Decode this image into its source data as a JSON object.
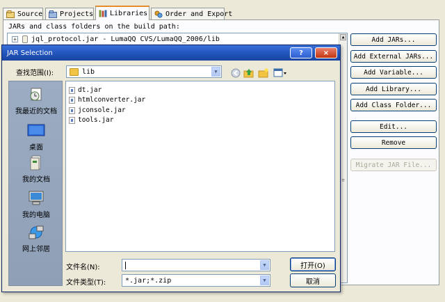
{
  "tabs": [
    {
      "label": "Source"
    },
    {
      "label": "Projects"
    },
    {
      "label": "Libraries",
      "active": true
    },
    {
      "label": "Order and Export"
    }
  ],
  "build_path": {
    "label": "JARs and class folders on the build path:",
    "entries": [
      {
        "label": "jql_protocol.jar - LumaQQ CVS/LumaQQ_2006/lib"
      }
    ]
  },
  "right_buttons": {
    "add_jars": "Add JARs...",
    "add_external_jars": "Add External JARs...",
    "add_variable": "Add Variable...",
    "add_library": "Add Library...",
    "add_class_folder": "Add Class Folder...",
    "edit": "Edit...",
    "remove": "Remove",
    "migrate": "Migrate JAR File..."
  },
  "dialog": {
    "title": "JAR Selection",
    "help_glyph": "?",
    "close_glyph": "×",
    "look_in_label": "查找范围(I):",
    "look_in_value": "lib",
    "places": [
      {
        "label": "我最近的文档",
        "icon": "recent-documents-icon"
      },
      {
        "label": "桌面",
        "icon": "desktop-icon"
      },
      {
        "label": "我的文档",
        "icon": "my-documents-icon"
      },
      {
        "label": "我的电脑",
        "icon": "my-computer-icon"
      },
      {
        "label": "网上邻居",
        "icon": "network-places-icon"
      }
    ],
    "files": [
      "dt.jar",
      "htmlconverter.jar",
      "jconsole.jar",
      "tools.jar"
    ],
    "file_name_label": "文件名(N):",
    "file_name_value": "",
    "file_type_label": "文件类型(T):",
    "file_type_value": "*.jar;*.zip",
    "open_button": "打开(O)",
    "cancel_button": "取消"
  },
  "colors": {
    "titlebar": "#2052b8",
    "active_tab_accent": "#e68b2c",
    "places_bar": "#95a5ba"
  }
}
